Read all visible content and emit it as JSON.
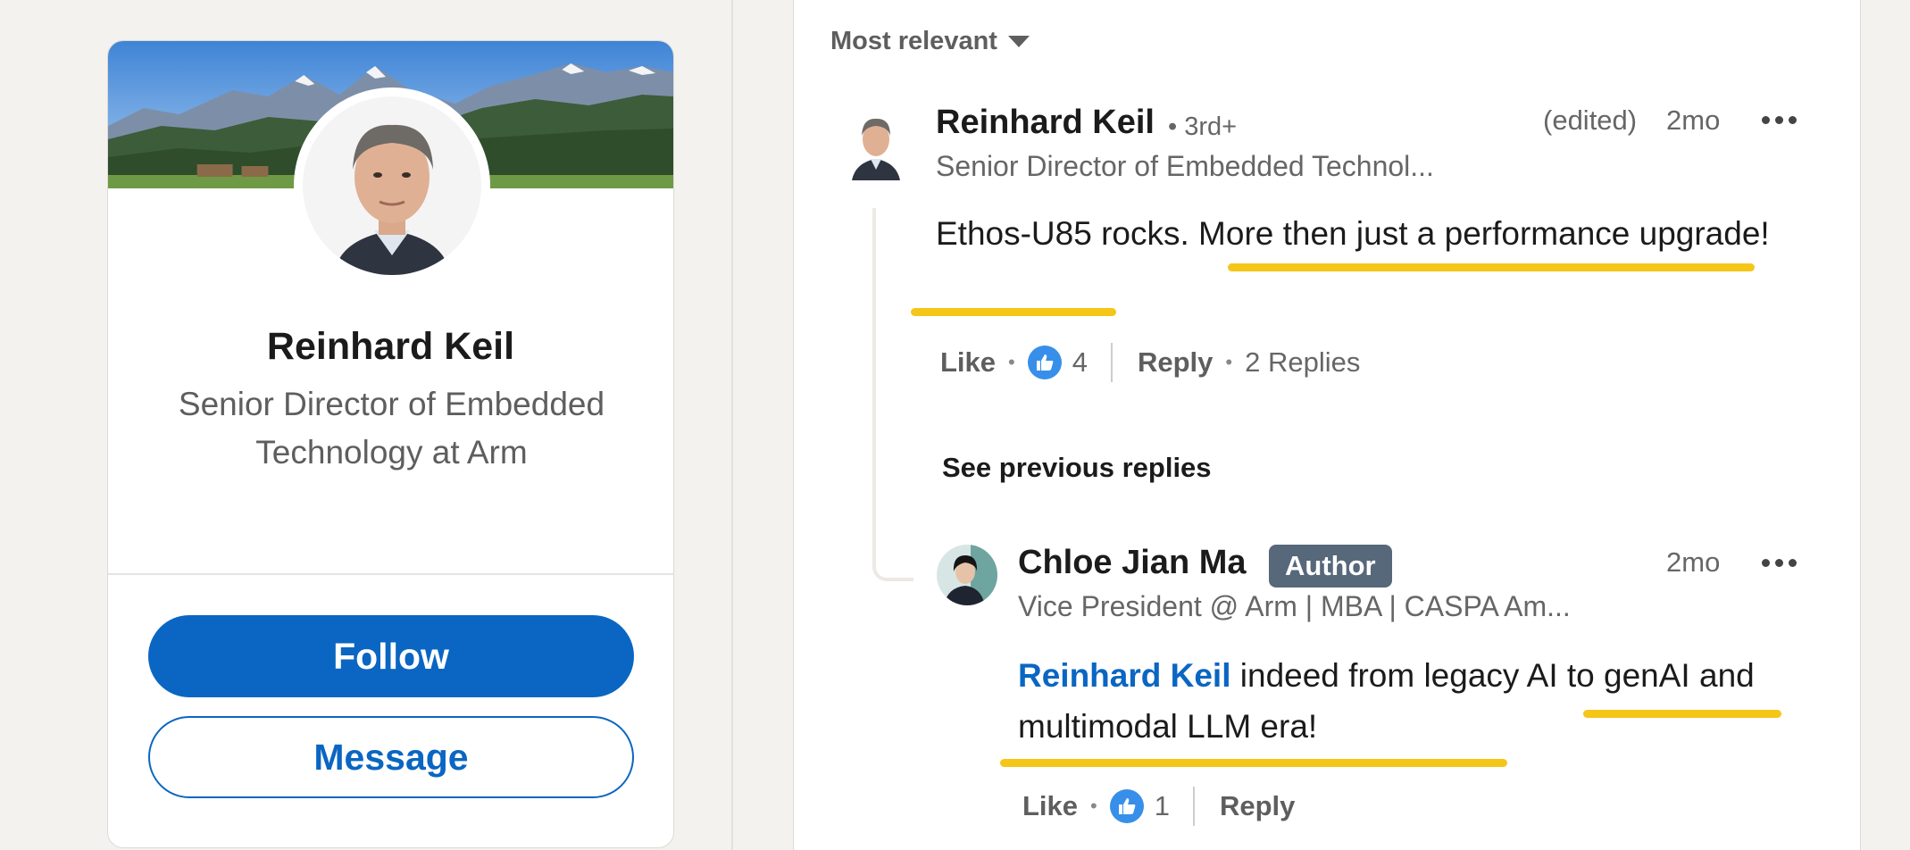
{
  "profile_card": {
    "name": "Reinhard Keil",
    "headline": "Senior Director of Embedded Technology at Arm",
    "follow_label": "Follow",
    "message_label": "Message"
  },
  "comments": {
    "sort_label": "Most relevant",
    "top_comment": {
      "author": "Reinhard Keil",
      "degree": "• 3rd+",
      "edited": "(edited)",
      "time": "2mo",
      "headline": "Senior Director of Embedded Technol...",
      "text": "Ethos-U85 rocks. More then just a performance upgrade!",
      "like_label": "Like",
      "reaction_count": "4",
      "reply_label": "Reply",
      "replies_count": "2 Replies"
    },
    "see_previous": "See previous replies",
    "reply": {
      "author": "Chloe Jian Ma",
      "badge": "Author",
      "time": "2mo",
      "headline": "Vice President @ Arm | MBA | CASPA Am...",
      "mention": "Reinhard Keil",
      "text": " indeed from legacy AI to genAI and multimodal LLM era!",
      "like_label": "Like",
      "reaction_count": "1",
      "reply_label": "Reply"
    }
  },
  "colors": {
    "brand_blue": "#0a66c2",
    "highlight_yellow": "#f5c518",
    "author_badge": "#56687a",
    "reaction_blue": "#378fe9"
  }
}
